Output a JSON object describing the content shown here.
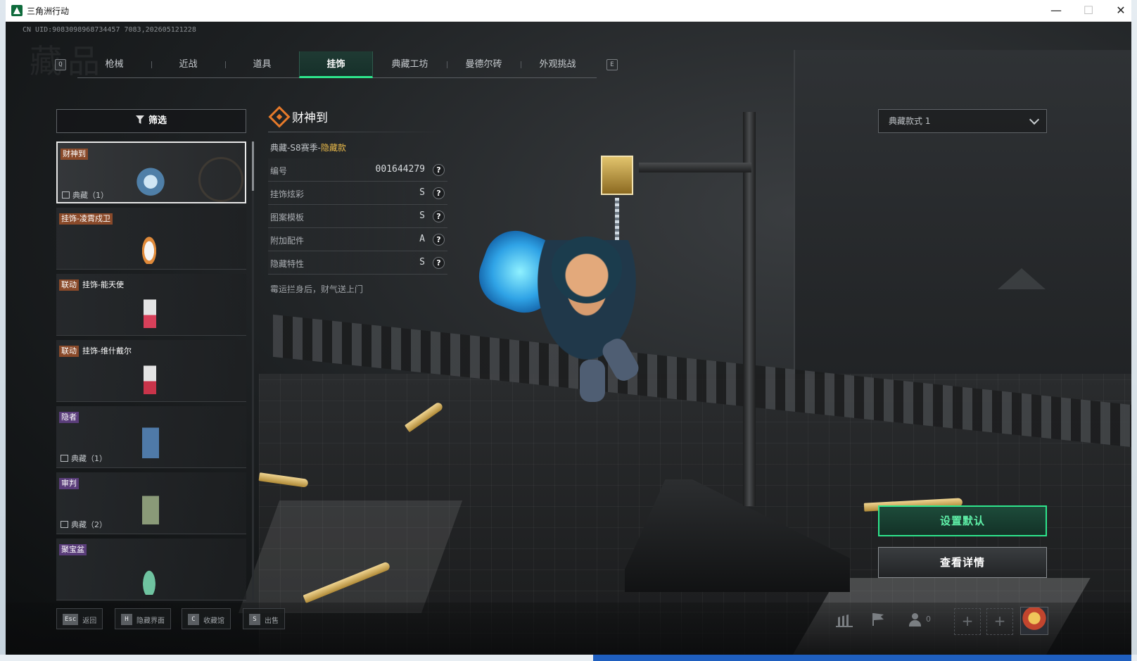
{
  "window": {
    "title": "三角洲行动",
    "controls": {
      "minimize": "—",
      "maximize": "☐",
      "close": "✕"
    }
  },
  "uid": "CN UID:9083098968734457 7083,202605121228",
  "watermark": "藏品",
  "tabs": {
    "prev_key": "Q",
    "next_key": "E",
    "items": [
      {
        "label": "枪械"
      },
      {
        "label": "近战"
      },
      {
        "label": "道具"
      },
      {
        "label": "挂饰",
        "active": true
      },
      {
        "label": "典藏工坊"
      },
      {
        "label": "曼德尔砖"
      },
      {
        "label": "外观挑战"
      }
    ]
  },
  "filter": {
    "label": "筛选"
  },
  "list": {
    "items": [
      {
        "tags": [
          {
            "text": "财神到",
            "color": "orange"
          }
        ],
        "collection": "典藏（1）",
        "selected": true
      },
      {
        "tags": [
          {
            "text": "挂饰-凌霄戍卫",
            "color": "orange"
          }
        ]
      },
      {
        "tags": [
          {
            "text": "联动",
            "color": "orange"
          },
          {
            "text": "挂饰-能天使",
            "color": "plain"
          }
        ]
      },
      {
        "tags": [
          {
            "text": "联动",
            "color": "orange"
          },
          {
            "text": "挂饰-维什戴尔",
            "color": "plain"
          }
        ]
      },
      {
        "tags": [
          {
            "text": "隐者",
            "color": "purple"
          }
        ],
        "collection": "典藏（1）"
      },
      {
        "tags": [
          {
            "text": "审判",
            "color": "purple"
          }
        ],
        "collection": "典藏（2）"
      },
      {
        "tags": [
          {
            "text": "聚宝盆",
            "color": "purple"
          }
        ]
      }
    ]
  },
  "detail": {
    "title": "财神到",
    "season_prefix": "典藏-S8赛季-",
    "season_highlight": "隐藏款",
    "rows": [
      {
        "key": "编号",
        "value": "001644279"
      },
      {
        "key": "挂饰炫彩",
        "value": "S"
      },
      {
        "key": "图案模板",
        "value": "S"
      },
      {
        "key": "附加配件",
        "value": "A"
      },
      {
        "key": "隐藏特性",
        "value": "S"
      }
    ],
    "help_glyph": "?",
    "description": "霉运拦身后，财气送上门"
  },
  "style_select": {
    "value": "典藏款式 1"
  },
  "buttons": {
    "set_default": "设置默认",
    "view_detail": "查看详情"
  },
  "hotkeys": [
    {
      "key": "Esc",
      "label": "返回"
    },
    {
      "key": "H",
      "label": "隐藏界面"
    },
    {
      "key": "C",
      "label": "收藏馆"
    },
    {
      "key": "S",
      "label": "出售"
    }
  ],
  "friends_count": "0",
  "slot_plus": "+",
  "colors": {
    "accent_green": "#2ee58c",
    "tag_orange": "#8a4a2a",
    "tag_purple": "#5a3d7a",
    "highlight_gold": "#e9b94a"
  }
}
